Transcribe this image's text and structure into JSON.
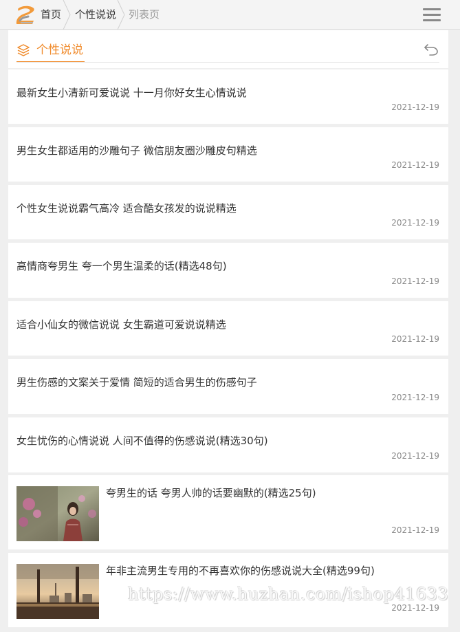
{
  "breadcrumb": {
    "home": "首页",
    "category": "个性说说",
    "current": "列表页"
  },
  "section": {
    "title": "个性说说"
  },
  "articles": [
    {
      "title": "最新女生小清新可爱说说 十一月你好女生心情说说",
      "date": "2021-12-19"
    },
    {
      "title": "男生女生都适用的沙雕句子 微信朋友圈沙雕皮句精选",
      "date": "2021-12-19"
    },
    {
      "title": "个性女生说说霸气高冷 适合酷女孩发的说说精选",
      "date": "2021-12-19"
    },
    {
      "title": "高情商夸男生 夸一个男生温柔的话(精选48句)",
      "date": "2021-12-19"
    },
    {
      "title": "适合小仙女的微信说说 女生霸道可爱说说精选",
      "date": "2021-12-19"
    },
    {
      "title": "男生伤感的文案关于爱情 简短的适合男生的伤感句子",
      "date": "2021-12-19"
    },
    {
      "title": "女生忧伤的心情说说 人间不值得的伤感说说(精选30句)",
      "date": "2021-12-19"
    },
    {
      "title": "夸男生的话 夸男人帅的话要幽默的(精选25句)",
      "date": "2021-12-19"
    },
    {
      "title": "年非主流男生专用的不再喜欢你的伤感说说大全(精选99句)",
      "date": "2021-12-19"
    }
  ],
  "watermark": "https://www.huzhan.com/ishop41633",
  "icons": {
    "logo": "site-logo",
    "menu": "hamburger-icon",
    "section": "layers-icon",
    "back": "back-arrow-icon"
  },
  "colors": {
    "accent": "#f08a2a",
    "date": "#888888",
    "crumb_current": "#999999"
  }
}
